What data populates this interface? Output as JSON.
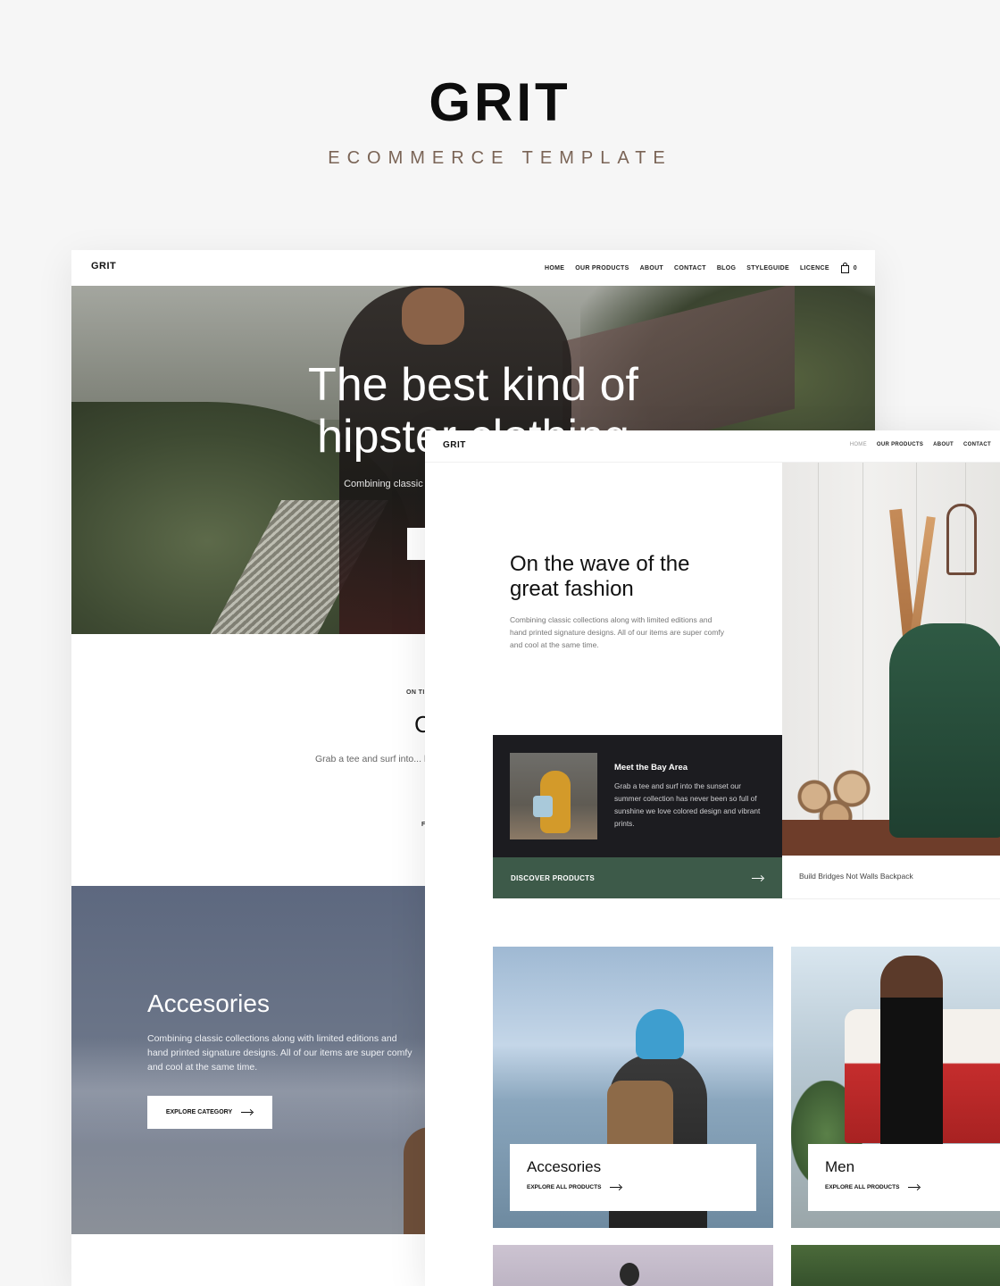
{
  "poster": {
    "title": "GRIT",
    "subtitle": "ECOMMERCE TEMPLATE"
  },
  "back": {
    "logo": "GRIT",
    "nav": [
      "HOME",
      "OUR PRODUCTS",
      "ABOUT",
      "CONTACT",
      "BLOG",
      "STYLEGUIDE",
      "LICENCE"
    ],
    "cart_count": "0",
    "hero": {
      "title_line1": "The best kind of",
      "title_line2": "hipster clothing",
      "text": "Combining classic collections along w... of our items are s..."
    },
    "mid": {
      "kicker": "ON TI",
      "big": "C",
      "para": "Grab a tee and surf into... been so full of sunshine... our collection exclusiv...",
      "tiny": "F"
    },
    "accessories": {
      "title": "Accesories",
      "text": "Combining classic collections along with limited editions and hand printed signature designs. All of our items are super comfy and cool at the same time.",
      "button": "EXPLORE CATEGORY"
    }
  },
  "front": {
    "logo": "GRIT",
    "nav": [
      "HOME",
      "OUR PRODUCTS",
      "ABOUT",
      "CONTACT"
    ],
    "wave_title": "On the wave of the great fashion",
    "wave_text": "Combining classic collections along with limited editions and hand printed signature designs. All of our items are super comfy and cool at the same time.",
    "card": {
      "title": "Meet the Bay Area",
      "text": "Grab a tee and surf into the sunset our summer collection has never been so full of sunshine we love colored design and vibrant prints."
    },
    "discover_button": "DISCOVER PRODUCTS",
    "caption": "Build Bridges Not Walls Backpack",
    "categories": [
      {
        "title": "Accesories",
        "link": "EXPLORE ALL PRODUCTS"
      },
      {
        "title": "Men",
        "link": "EXPLORE ALL PRODUCTS"
      }
    ]
  }
}
